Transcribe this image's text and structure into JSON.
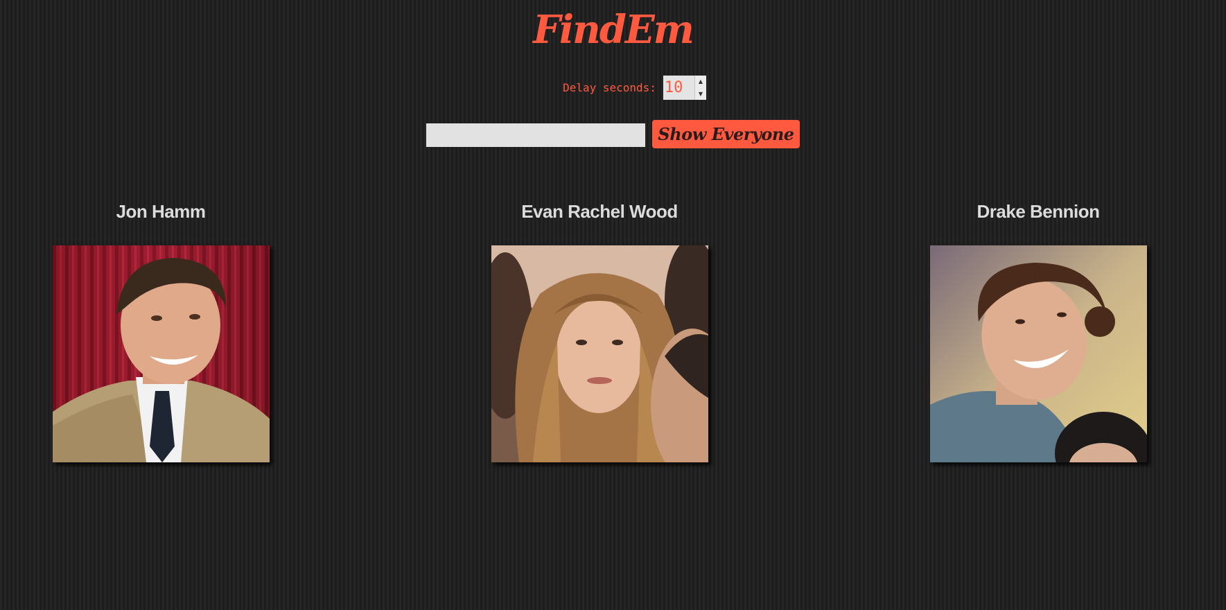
{
  "app": {
    "title": "FindEm"
  },
  "delay": {
    "label": "Delay seconds:",
    "value": "10"
  },
  "search": {
    "value": "",
    "button_label": "Show Everyone"
  },
  "people": [
    {
      "name": "Jon Hamm"
    },
    {
      "name": "Evan Rachel Wood"
    },
    {
      "name": "Drake Bennion"
    }
  ],
  "colors": {
    "accent": "#ff5a40",
    "background": "#222222",
    "name_text": "#dcdcdc"
  }
}
